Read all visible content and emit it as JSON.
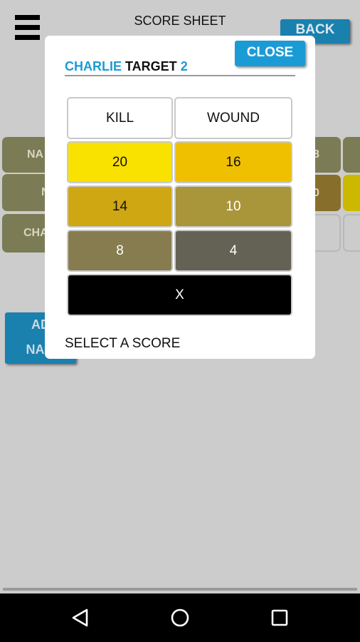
{
  "header": {
    "title": "SCORE SHEET",
    "back_label": "BACK",
    "menu_icon": "hamburger-menu-icon"
  },
  "background": {
    "rows": [
      {
        "label": "NA",
        "right_value": "8",
        "colors": [
          "#7b7b55",
          "#7b7b55",
          "#7b7b55"
        ]
      },
      {
        "label": "N",
        "right_value": "0",
        "colors": [
          "#7b7b55",
          "#876f2b",
          "#cdb800"
        ]
      },
      {
        "label": "CHA",
        "right_value": "",
        "colors": [
          "#7b7b55",
          "#cccccc",
          "#cccccc"
        ]
      }
    ],
    "add_name_label_line1": "AD",
    "add_name_label_line2": "NAM"
  },
  "dialog": {
    "player_name": "CHARLIE",
    "target_label": "TARGET",
    "target_number": "2",
    "close_label": "CLOSE",
    "columns": [
      "KILL",
      "WOUND"
    ],
    "scores": [
      {
        "value": "20",
        "color": "#f9e100",
        "text_color": "#111111"
      },
      {
        "value": "16",
        "color": "#eec000",
        "text_color": "#111111"
      },
      {
        "value": "14",
        "color": "#cfa712",
        "text_color": "#111111"
      },
      {
        "value": "10",
        "color": "#a9953a",
        "text_color": "#ffffff"
      },
      {
        "value": "8",
        "color": "#877c4f",
        "text_color": "#ffffff"
      },
      {
        "value": "4",
        "color": "#646254",
        "text_color": "#ffffff"
      }
    ],
    "miss": {
      "value": "X",
      "color": "#000000",
      "text_color": "#ffffff"
    },
    "status": "SELECT A SCORE"
  },
  "navbar": {
    "back_icon": "back-triangle-icon",
    "home_icon": "home-circle-icon",
    "recents_icon": "recents-square-icon"
  }
}
